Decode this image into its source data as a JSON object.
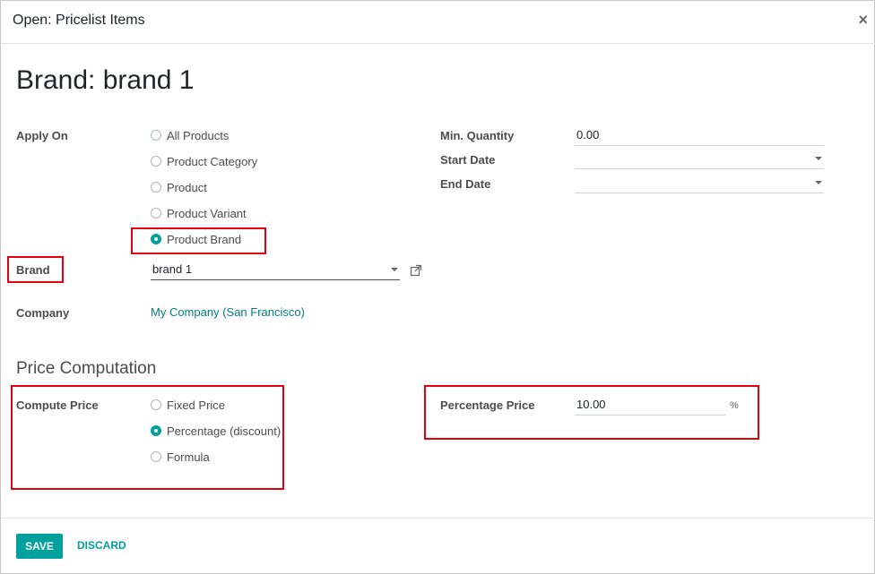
{
  "dialog": {
    "title": "Open: Pricelist Items",
    "close_glyph": "×"
  },
  "record": {
    "title": "Brand: brand 1"
  },
  "apply_on": {
    "label": "Apply On",
    "options": [
      {
        "label": "All Products",
        "checked": false
      },
      {
        "label": "Product Category",
        "checked": false
      },
      {
        "label": "Product",
        "checked": false
      },
      {
        "label": "Product Variant",
        "checked": false
      },
      {
        "label": "Product Brand",
        "checked": true
      }
    ]
  },
  "brand": {
    "label": "Brand",
    "value": "brand 1"
  },
  "company": {
    "label": "Company",
    "value": "My Company (San Francisco)"
  },
  "right_fields": {
    "min_quantity": {
      "label": "Min. Quantity",
      "value": "0.00"
    },
    "start_date": {
      "label": "Start Date",
      "value": ""
    },
    "end_date": {
      "label": "End Date",
      "value": ""
    }
  },
  "price_computation": {
    "section_title": "Price Computation",
    "compute_label": "Compute Price",
    "options": [
      {
        "label": "Fixed Price",
        "checked": false
      },
      {
        "label": "Percentage (discount)",
        "checked": true
      },
      {
        "label": "Formula",
        "checked": false
      }
    ],
    "percentage_label": "Percentage Price",
    "percentage_value": "10.00",
    "percentage_unit": "%"
  },
  "footer": {
    "save_label": "SAVE",
    "discard_label": "DISCARD"
  },
  "colors": {
    "accent": "#00a09d",
    "link": "#017e84",
    "highlight": "#e4000f"
  },
  "icons": {
    "close": "close-icon",
    "external": "external-link-icon",
    "dropdown": "chevron-down-icon"
  }
}
